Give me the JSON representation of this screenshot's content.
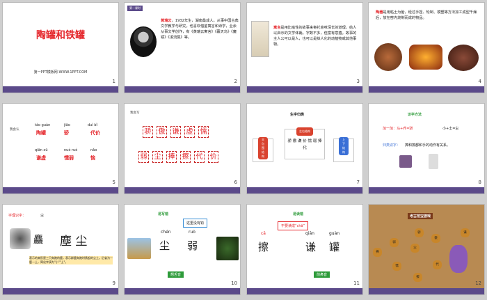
{
  "slides": [
    {
      "number": "1",
      "title": "陶罐和铁罐",
      "subtitle": "第一PPT模板网-WWW.1PPT.COM"
    },
    {
      "number": "2",
      "tag": "第一课时",
      "author": "黄瑞云",
      "text": "，1932年生，湖南桑成人。从事中国古典文学教学与研究。也喜欢借鉴寓言和诗学，业余从事文学创作，有《黄瑞云寓言》《暮天鸟》《魔镜》《溪流集》等。"
    },
    {
      "number": "3",
      "keyword": "寓言",
      "text": "是用比喻性的故事来寄托意味深长的道理，给人以启示的文学体裁。字数不多，但富有意蕴。故事的主人公可以是人，也可以是拟人化的动植物或其他事物。"
    },
    {
      "number": "4",
      "keyword": "陶器",
      "text": "是用粘土为胎，经过手捏、轮制、模塑等方法加工成型千燥后，放在窑内烧制而成的物品。"
    },
    {
      "number": "5",
      "label": "我会认",
      "words": [
        {
          "py": "táo guàn",
          "hz": "陶罐"
        },
        {
          "py": "jiāo",
          "hz": "骄"
        },
        {
          "py": "duì bǐ",
          "hz": "代价"
        },
        {
          "py": "qiān xū",
          "hz": "谦虚"
        },
        {
          "py": "nuò ruò",
          "hz": "懦弱"
        },
        {
          "py": "nǎo",
          "hz": "恼"
        }
      ]
    },
    {
      "number": "6",
      "label": "我会写",
      "row1": [
        "骄",
        "傲",
        "谦",
        "虚",
        "懦"
      ],
      "row2": [
        "弱",
        "尘",
        "捧",
        "擦",
        "代",
        "价"
      ]
    },
    {
      "number": "7",
      "title": "生字归类",
      "groups": [
        {
          "header": "半包围结构",
          "chars": "虚"
        },
        {
          "header": "左右结构",
          "chars": "骄 傲 谦 价  懦 弱 捧 代"
        },
        {
          "header": "上下结构",
          "chars": "尘"
        }
      ]
    },
    {
      "number": "8",
      "title": "识字方法",
      "line1": "加一加：马+乔=骄",
      "line2": "小+土=尘",
      "line3label": "归类识字：",
      "line3": "捧和擦都和手的动作有关系。"
    },
    {
      "number": "9",
      "label": "字理识字：",
      "focus": "尘",
      "small": "麤",
      "big": "塵 尘",
      "caption": "表示的来形是三只奔跑的鹿，表示群鹿奔跑时扬起的尘土。后省为一鹿一土，简化字演为\"小\"\"土\"。"
    },
    {
      "number": "10",
      "title": "易写错",
      "bubble": "这里没有钩",
      "py1": "chén",
      "hz1": "尘",
      "py2": "ruò",
      "hz2": "弱",
      "note": "翘舌音"
    },
    {
      "number": "11",
      "title": "易读错",
      "bubble": "不要读成“chā”",
      "py1": "cā",
      "hz1": "擦",
      "py2": "qiān",
      "hz2": "谦",
      "py3": "guàn",
      "hz3": "罐",
      "note": "前鼻音"
    },
    {
      "number": "12",
      "banner": "考古挖宝游戏",
      "jars": [
        "骄",
        "傲",
        "尘",
        "代",
        "价",
        "弱",
        "捧",
        "擦",
        "懦",
        "谦"
      ]
    }
  ]
}
